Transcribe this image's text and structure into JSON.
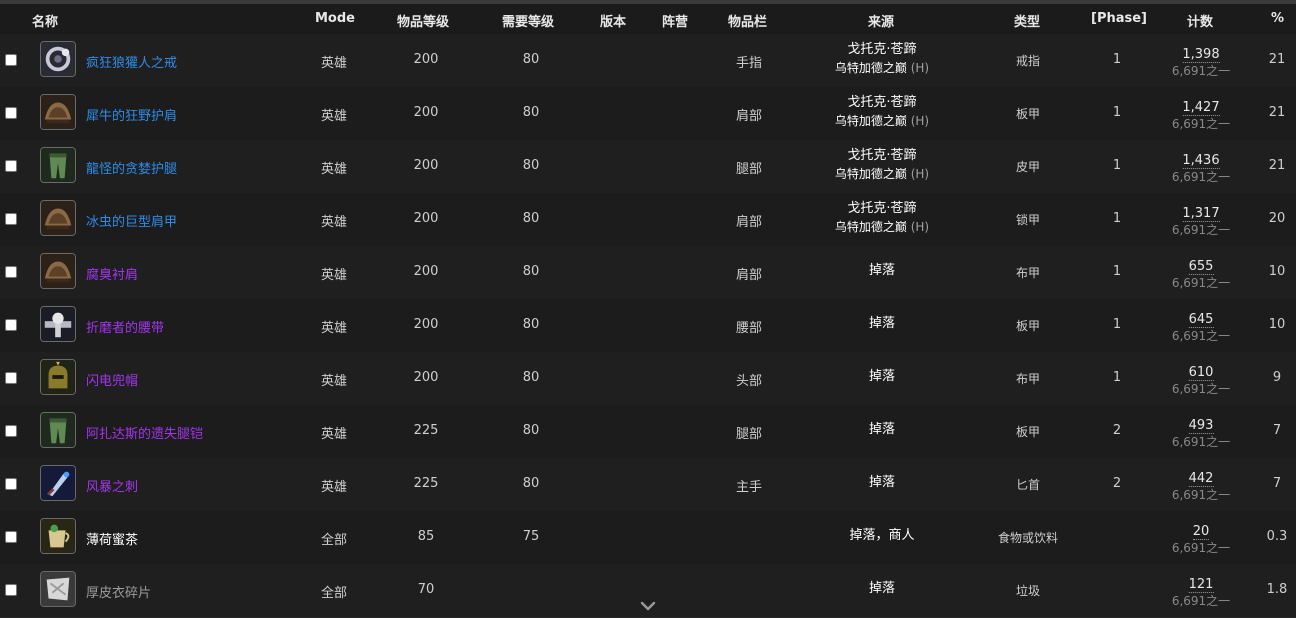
{
  "columns": {
    "name": "名称",
    "mode": "Mode",
    "item_level": "物品等级",
    "req_level": "需要等级",
    "version": "版本",
    "faction": "阵营",
    "slot": "物品栏",
    "source": "来源",
    "type": "类型",
    "phase": "[Phase]",
    "count": "计数",
    "percent": "%"
  },
  "quality_colors": {
    "rare": "#2f8ce8",
    "epic": "#a335ee",
    "common": "#ffffff",
    "poor": "#9d9d9d"
  },
  "rows": [
    {
      "icon": "ring-icon",
      "name": "疯狂狼獾人之戒",
      "quality": "rare",
      "mode": "英雄",
      "ilvl": "200",
      "req": "80",
      "slot": "手指",
      "src1": "戈托克·苍蹄",
      "src2": "乌特加德之巅",
      "src_mode": "(H)",
      "type": "戒指",
      "phase": "1",
      "count": "1,398",
      "of": "6,691之一",
      "pct": "21"
    },
    {
      "icon": "shoulder-icon",
      "name": "犀牛的狂野护肩",
      "quality": "rare",
      "mode": "英雄",
      "ilvl": "200",
      "req": "80",
      "slot": "肩部",
      "src1": "戈托克·苍蹄",
      "src2": "乌特加德之巅",
      "src_mode": "(H)",
      "type": "板甲",
      "phase": "1",
      "count": "1,427",
      "of": "6,691之一",
      "pct": "21"
    },
    {
      "icon": "legs-icon",
      "name": "龍怪的贪婪护腿",
      "quality": "rare",
      "mode": "英雄",
      "ilvl": "200",
      "req": "80",
      "slot": "腿部",
      "src1": "戈托克·苍蹄",
      "src2": "乌特加德之巅",
      "src_mode": "(H)",
      "type": "皮甲",
      "phase": "1",
      "count": "1,436",
      "of": "6,691之一",
      "pct": "21"
    },
    {
      "icon": "shoulder-icon",
      "name": "冰虫的巨型肩甲",
      "quality": "rare",
      "mode": "英雄",
      "ilvl": "200",
      "req": "80",
      "slot": "肩部",
      "src1": "戈托克·苍蹄",
      "src2": "乌特加德之巅",
      "src_mode": "(H)",
      "type": "锁甲",
      "phase": "1",
      "count": "1,317",
      "of": "6,691之一",
      "pct": "20"
    },
    {
      "icon": "shoulder-icon",
      "name": "腐臭衬肩",
      "quality": "epic",
      "mode": "英雄",
      "ilvl": "200",
      "req": "80",
      "slot": "肩部",
      "src1": "掉落",
      "src2": "",
      "src_mode": "",
      "type": "布甲",
      "phase": "1",
      "count": "655",
      "of": "6,691之一",
      "pct": "10"
    },
    {
      "icon": "belt-icon",
      "name": "折磨者的腰带",
      "quality": "epic",
      "mode": "英雄",
      "ilvl": "200",
      "req": "80",
      "slot": "腰部",
      "src1": "掉落",
      "src2": "",
      "src_mode": "",
      "type": "板甲",
      "phase": "1",
      "count": "645",
      "of": "6,691之一",
      "pct": "10"
    },
    {
      "icon": "helm-icon",
      "name": "闪电兜帽",
      "quality": "epic",
      "mode": "英雄",
      "ilvl": "200",
      "req": "80",
      "slot": "头部",
      "src1": "掉落",
      "src2": "",
      "src_mode": "",
      "type": "布甲",
      "phase": "1",
      "count": "610",
      "of": "6,691之一",
      "pct": "9"
    },
    {
      "icon": "legs-icon",
      "name": "阿扎达斯的遗失腿铠",
      "quality": "epic",
      "mode": "英雄",
      "ilvl": "225",
      "req": "80",
      "slot": "腿部",
      "src1": "掉落",
      "src2": "",
      "src_mode": "",
      "type": "板甲",
      "phase": "2",
      "count": "493",
      "of": "6,691之一",
      "pct": "7"
    },
    {
      "icon": "dagger-icon",
      "name": "风暴之刺",
      "quality": "epic",
      "mode": "英雄",
      "ilvl": "225",
      "req": "80",
      "slot": "主手",
      "src1": "掉落",
      "src2": "",
      "src_mode": "",
      "type": "匕首",
      "phase": "2",
      "count": "442",
      "of": "6,691之一",
      "pct": "7"
    },
    {
      "icon": "tea-icon",
      "name": "薄荷蜜茶",
      "quality": "common",
      "mode": "全部",
      "ilvl": "85",
      "req": "75",
      "slot": "",
      "src1": "掉落，商人",
      "src2": "",
      "src_mode": "",
      "type": "食物或饮料",
      "phase": "",
      "count": "20",
      "of": "6,691之一",
      "pct": "0.3"
    },
    {
      "icon": "cloth-scrap-icon",
      "name": "厚皮衣碎片",
      "quality": "poor",
      "mode": "全部",
      "ilvl": "70",
      "req": "",
      "slot": "",
      "src1": "掉落",
      "src2": "",
      "src_mode": "",
      "type": "垃圾",
      "phase": "",
      "count": "121",
      "of": "6,691之一",
      "pct": "1.8"
    }
  ],
  "scroll_icon": "chevron-down-icon"
}
